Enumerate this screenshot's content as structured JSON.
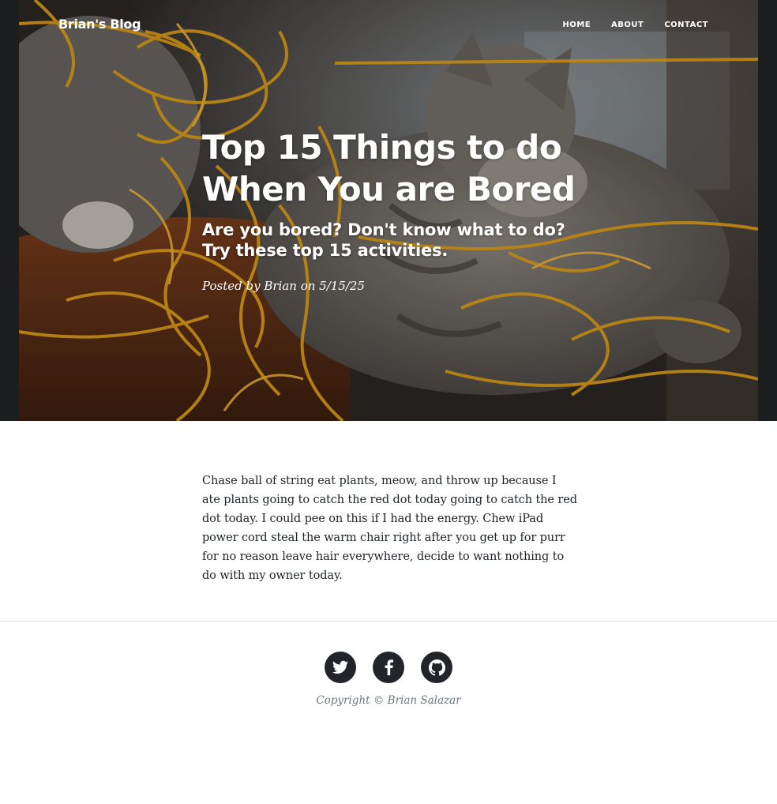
{
  "nav": {
    "brand": "Brian's Blog",
    "links": [
      {
        "label": "HOME"
      },
      {
        "label": "ABOUT"
      },
      {
        "label": "CONTACT"
      }
    ]
  },
  "hero": {
    "image": "cat-playing-with-orange-yarn",
    "title_line1": "Top 15 Things to do",
    "title_line2": "When You are Bored",
    "subtitle": "Are you bored? Don't know what to do? Try these top 15 activities.",
    "meta": "Posted by Brian on 5/15/25"
  },
  "article": {
    "body": "Chase ball of string eat plants, meow, and throw up because I ate plants going to catch the red dot today going to catch the red dot today. I could pee on this if I had the energy. Chew iPad power cord steal the warm chair right after you get up for purr for no reason leave hair everywhere, decide to want nothing to do with my owner today."
  },
  "footer": {
    "social": [
      {
        "icon": "twitter-icon"
      },
      {
        "icon": "facebook-icon"
      },
      {
        "icon": "github-icon"
      }
    ],
    "copyright": "Copyright © Brian Salazar"
  },
  "colors": {
    "hero_bg": "#1c1d1f",
    "yarn": "#e3a21a",
    "text": "#212529",
    "muted": "#6c757d",
    "divider": "#dee2e6"
  }
}
